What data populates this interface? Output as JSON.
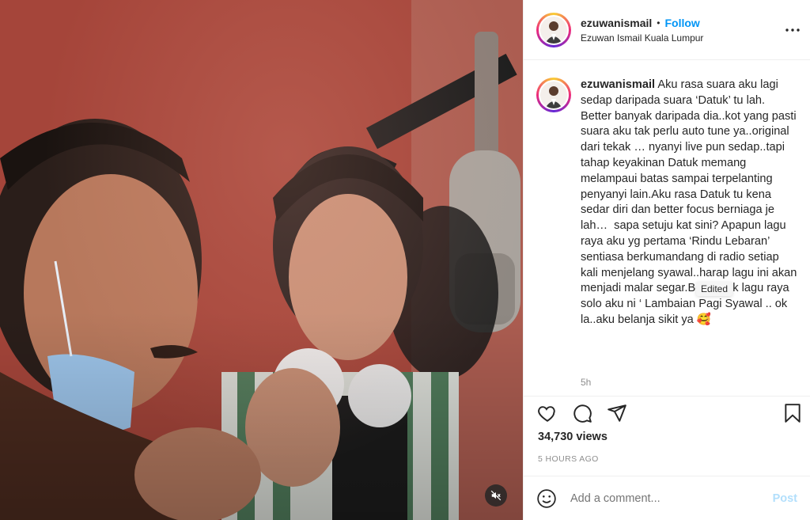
{
  "header": {
    "username": "ezuwanismail",
    "dot": "•",
    "follow_label": "Follow",
    "subline": "Ezuwan Ismail Kuala Lumpur",
    "more_icon": "more-horizontal-icon"
  },
  "caption": {
    "username": "ezuwanismail",
    "text": "Aku rasa suara aku lagi sedap daripada suara ‘Datuk’ tu lah. Better banyak daripada dia..kot yang pasti suara aku tak perlu auto tune ya..original dari tekak … nyanyi live pun sedap..tapi tahap keyakinan Datuk memang melampaui batas sampai terpelanting penyanyi lain.Aku rasa Datuk tu kena sedar diri dan better focus berniaga je lah…  sapa setuju kat sini? Apapun lagu raya aku yg pertama ‘Rindu Lebaran’ sentiasa berkumandang di radio setiap kali menjelang syawal..harap lagu ini akan menjadi malar segar.Begitu jgk lagu raya solo aku ni ‘ Lambaian Pagi Syawal .. ok la..aku belanja sikit ya 🥰",
    "edited_tooltip": "Edited",
    "time_ago": "5h"
  },
  "actions": {
    "like_icon": "heart-icon",
    "comment_icon": "comment-icon",
    "share_icon": "paper-plane-icon",
    "save_icon": "bookmark-icon"
  },
  "stats": {
    "views": "34,730 views",
    "posted": "5 HOURS AGO"
  },
  "comment": {
    "emoji_icon": "smiley-icon",
    "placeholder": "Add a comment...",
    "post_label": "Post"
  },
  "media": {
    "mute_icon": "speaker-muted-icon"
  },
  "colors": {
    "accent": "#0095f6",
    "post_disabled": "#b2dffc",
    "secondary_text": "#8e8e8e"
  }
}
